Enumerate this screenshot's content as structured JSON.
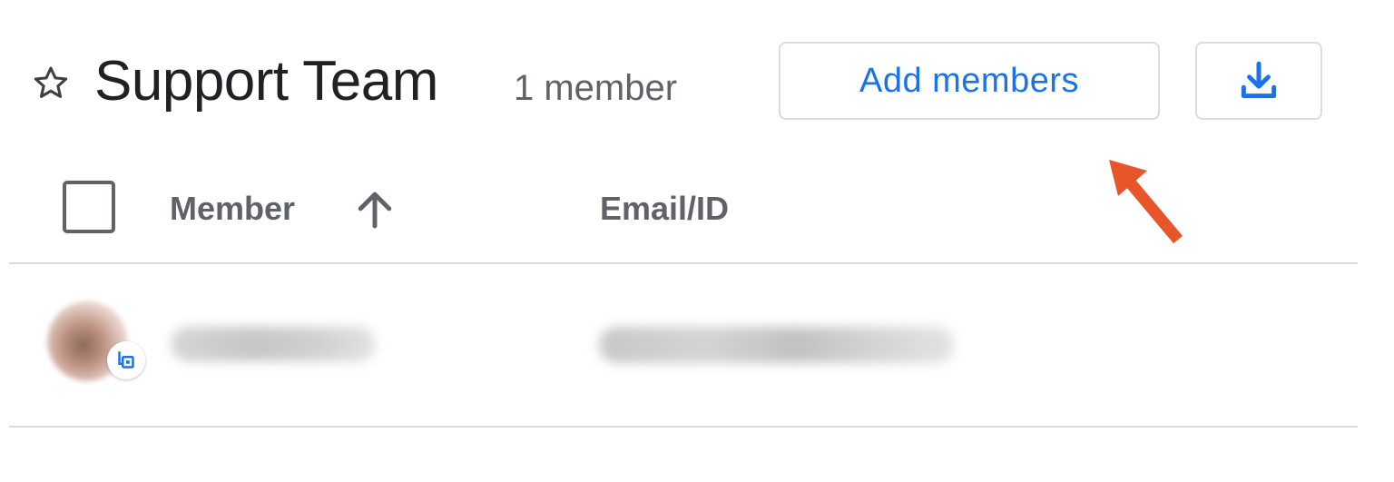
{
  "header": {
    "title": "Support Team",
    "member_count": "1 member",
    "add_members_label": "Add members",
    "star_icon": "star-outline-icon",
    "download_icon": "download-icon"
  },
  "table": {
    "columns": [
      "Member",
      "Email/ID"
    ],
    "sort_icon": "arrow-upward-icon",
    "sort_direction": "ascending",
    "rows": [
      {
        "avatar_icon": "avatar",
        "badge_icon": "domain-badge-icon"
      }
    ]
  },
  "colors": {
    "accent": "#1a73e8",
    "text_primary": "#202124",
    "text_secondary": "#5f6368",
    "border": "#dadce0",
    "annotation": "#e8552b"
  }
}
